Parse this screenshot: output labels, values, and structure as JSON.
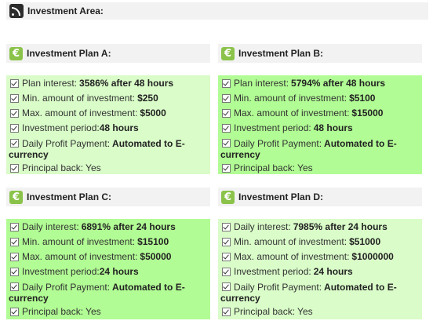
{
  "header": {
    "title": "Investment Area:",
    "icon": "rss-icon"
  },
  "plans": [
    {
      "title": "Investment Plan A:",
      "rows": [
        {
          "label": "Plan interest:",
          "value": "3586% after 48 hours"
        },
        {
          "label": "Min. amount of investment:",
          "value": "$250"
        },
        {
          "label": "Max. amount of investment:",
          "value": "$5000"
        },
        {
          "label": "Investment period:",
          "value": "48 hours"
        },
        {
          "label": "Daily Profit Payment:",
          "value": "Automated to E-currency"
        },
        {
          "label": "Principal back:",
          "value": "Yes"
        }
      ]
    },
    {
      "title": "Investment Plan B:",
      "rows": [
        {
          "label": "Plan interest:",
          "value": "5794% after 48 hours"
        },
        {
          "label": "Min. amount of investment:",
          "value": "$5100"
        },
        {
          "label": "Max. amount of investment:",
          "value": "$15000"
        },
        {
          "label": "Investment period:",
          "value": "48 hours"
        },
        {
          "label": "Daily Profit Payment:",
          "value": "Automated to E-currency"
        },
        {
          "label": "Principal back:",
          "value": "Yes"
        }
      ]
    },
    {
      "title": "Investment Plan C:",
      "rows": [
        {
          "label": "Daily interest:",
          "value": "6891% after 24 hours"
        },
        {
          "label": "Min. amount of investment:",
          "value": "$15100"
        },
        {
          "label": "Max. amount of investment:",
          "value": "$50000"
        },
        {
          "label": "Investment period:",
          "value": "24 hours"
        },
        {
          "label": "Daily Profit Payment:",
          "value": "Automated to E-currency"
        },
        {
          "label": "Principal back:",
          "value": "Yes"
        }
      ]
    },
    {
      "title": "Investment Plan D:",
      "rows": [
        {
          "label": "Daily interest:",
          "value": "7985% after 24 hours"
        },
        {
          "label": "Min. amount of investment:",
          "value": "$51000"
        },
        {
          "label": "Max. amount of investment:",
          "value": "$1000000"
        },
        {
          "label": "Investment period:",
          "value": "24 hours"
        },
        {
          "label": "Daily Profit Payment:",
          "value": "Automated to E-currency"
        },
        {
          "label": "Principal back:",
          "value": "Yes"
        }
      ]
    }
  ],
  "colors": {
    "panel_light": "#d9fcc8",
    "panel_green": "#b1fc94",
    "header_bg": "#f2f2f2",
    "plan_icon": "#8bc34a"
  }
}
